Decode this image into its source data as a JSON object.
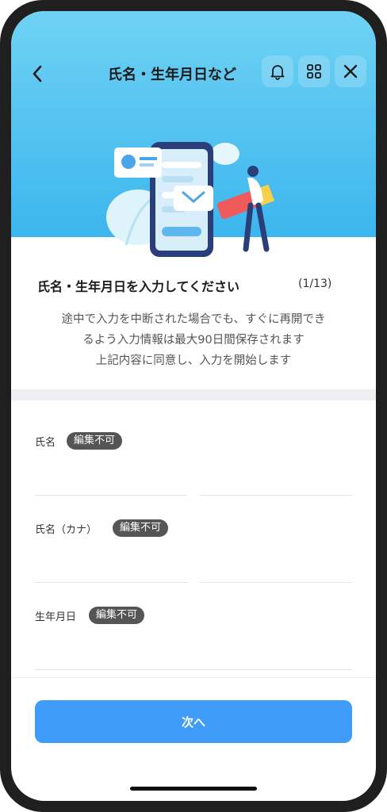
{
  "header": {
    "title": "氏名・生年月日など",
    "icons": [
      "back-icon",
      "bell-icon",
      "grid-icon",
      "close-icon"
    ]
  },
  "intro": {
    "heading": "氏名・生年月日を入力してください",
    "step": "(1/13)",
    "description_lines": [
      "途中で入力を中断された場合でも、すぐに再開でき",
      "るよう入力情報は最大90日間保存されます",
      "上記内容に同意し、入力を開始します"
    ]
  },
  "form": {
    "fields": [
      {
        "label": "氏名",
        "badge": "編集不可"
      },
      {
        "label": "氏名（カナ）",
        "badge": "編集不可"
      },
      {
        "label": "生年月日",
        "badge": "編集不可"
      }
    ]
  },
  "footer": {
    "next_label": "次へ"
  },
  "colors": {
    "hero_top": "#6fd2f4",
    "hero_bottom": "#3cb6ee",
    "primary_button": "#3f9cf8",
    "badge": "#555555"
  }
}
